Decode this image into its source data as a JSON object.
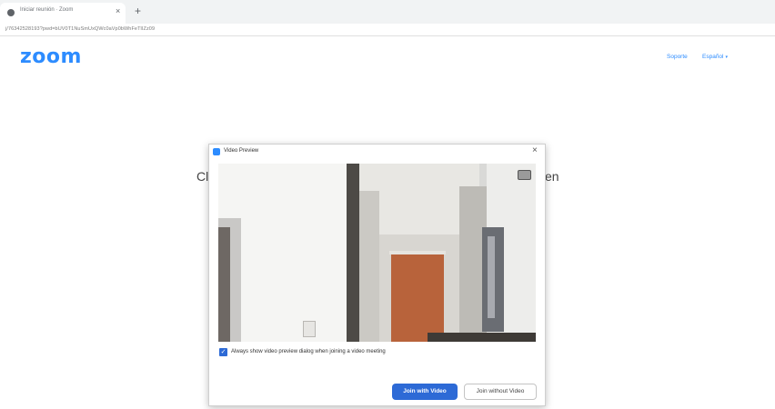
{
  "browser": {
    "tab_title": "Iniciar reunión · Zoom",
    "tab_close": "×",
    "new_tab": "+",
    "url": "j/76342528193?pwd=bUV0T1NuSmUxQWc0aVp0bWhFeTlIZz09"
  },
  "header": {
    "logo": "zoom",
    "support_label": "Soporte",
    "language_label": "Español",
    "language_caret": "▾"
  },
  "background": {
    "left_text": "Cl",
    "right_text": "en"
  },
  "dialog": {
    "title": "Video Preview",
    "close": "×",
    "checkbox_checked": true,
    "checkbox_mark": "✓",
    "checkbox_label": "Always show video preview dialog when joining a video meeting",
    "join_with_video": "Join with Video",
    "join_without_video": "Join without Video"
  },
  "colors": {
    "brand": "#2d8cff",
    "primary_button": "#2d6ad6"
  },
  "icons": {
    "favicon": "globe-icon",
    "app_icon": "zoom-app-icon",
    "camera_toggle": "camera-settings-icon"
  }
}
